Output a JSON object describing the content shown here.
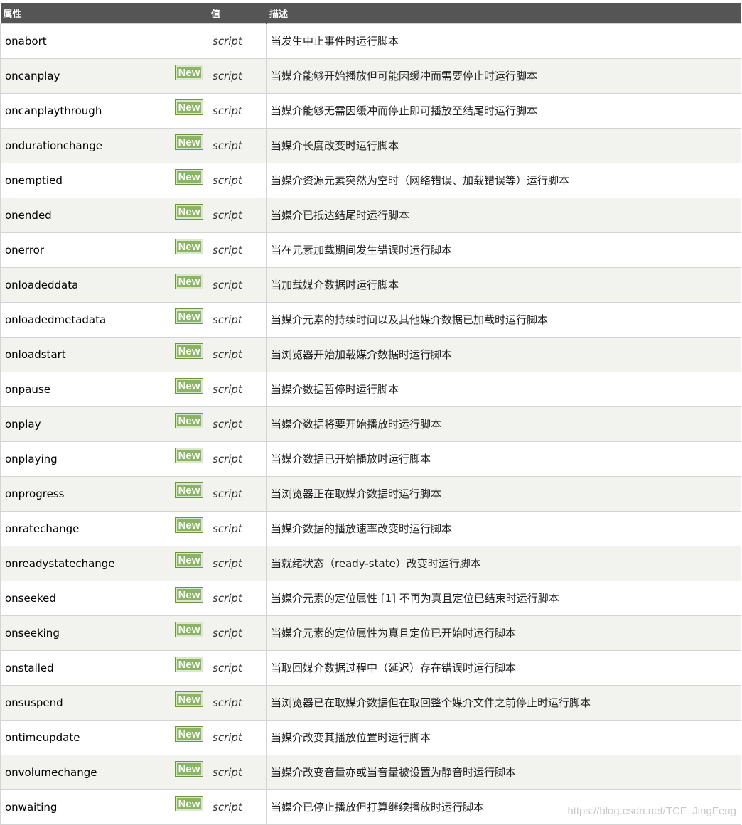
{
  "headers": {
    "attribute": "属性",
    "value": "值",
    "description": "描述"
  },
  "badge_text": "New",
  "badge_color": "#8bb465",
  "header_color": "#555555",
  "rows": [
    {
      "attr": "onabort",
      "new": false,
      "value": "script",
      "desc": "当发生中止事件时运行脚本"
    },
    {
      "attr": "oncanplay",
      "new": true,
      "value": "script",
      "desc": "当媒介能够开始播放但可能因缓冲而需要停止时运行脚本"
    },
    {
      "attr": "oncanplaythrough",
      "new": true,
      "value": "script",
      "desc": "当媒介能够无需因缓冲而停止即可播放至结尾时运行脚本"
    },
    {
      "attr": "ondurationchange",
      "new": true,
      "value": "script",
      "desc": "当媒介长度改变时运行脚本"
    },
    {
      "attr": "onemptied",
      "new": true,
      "value": "script",
      "desc": "当媒介资源元素突然为空时（网络错误、加载错误等）运行脚本"
    },
    {
      "attr": "onended",
      "new": true,
      "value": "script",
      "desc": "当媒介已抵达结尾时运行脚本"
    },
    {
      "attr": "onerror",
      "new": true,
      "value": "script",
      "desc": "当在元素加载期间发生错误时运行脚本"
    },
    {
      "attr": "onloadeddata",
      "new": true,
      "value": "script",
      "desc": "当加载媒介数据时运行脚本"
    },
    {
      "attr": "onloadedmetadata",
      "new": true,
      "value": "script",
      "desc": "当媒介元素的持续时间以及其他媒介数据已加载时运行脚本"
    },
    {
      "attr": "onloadstart",
      "new": true,
      "value": "script",
      "desc": "当浏览器开始加载媒介数据时运行脚本"
    },
    {
      "attr": "onpause",
      "new": true,
      "value": "script",
      "desc": "当媒介数据暂停时运行脚本"
    },
    {
      "attr": "onplay",
      "new": true,
      "value": "script",
      "desc": "当媒介数据将要开始播放时运行脚本"
    },
    {
      "attr": "onplaying",
      "new": true,
      "value": "script",
      "desc": "当媒介数据已开始播放时运行脚本"
    },
    {
      "attr": "onprogress",
      "new": true,
      "value": "script",
      "desc": "当浏览器正在取媒介数据时运行脚本"
    },
    {
      "attr": "onratechange",
      "new": true,
      "value": "script",
      "desc": "当媒介数据的播放速率改变时运行脚本"
    },
    {
      "attr": "onreadystatechange",
      "new": true,
      "value": "script",
      "desc": "当就绪状态（ready-state）改变时运行脚本"
    },
    {
      "attr": "onseeked",
      "new": true,
      "value": "script",
      "desc": "当媒介元素的定位属性 [1] 不再为真且定位已结束时运行脚本"
    },
    {
      "attr": "onseeking",
      "new": true,
      "value": "script",
      "desc": "当媒介元素的定位属性为真且定位已开始时运行脚本"
    },
    {
      "attr": "onstalled",
      "new": true,
      "value": "script",
      "desc": "当取回媒介数据过程中（延迟）存在错误时运行脚本"
    },
    {
      "attr": "onsuspend",
      "new": true,
      "value": "script",
      "desc": "当浏览器已在取媒介数据但在取回整个媒介文件之前停止时运行脚本"
    },
    {
      "attr": "ontimeupdate",
      "new": true,
      "value": "script",
      "desc": "当媒介改变其播放位置时运行脚本"
    },
    {
      "attr": "onvolumechange",
      "new": true,
      "value": "script",
      "desc": "当媒介改变音量亦或当音量被设置为静音时运行脚本"
    },
    {
      "attr": "onwaiting",
      "new": true,
      "value": "script",
      "desc": "当媒介已停止播放但打算继续播放时运行脚本"
    }
  ],
  "watermark": "https://blog.csdn.net/TCF_JingFeng"
}
